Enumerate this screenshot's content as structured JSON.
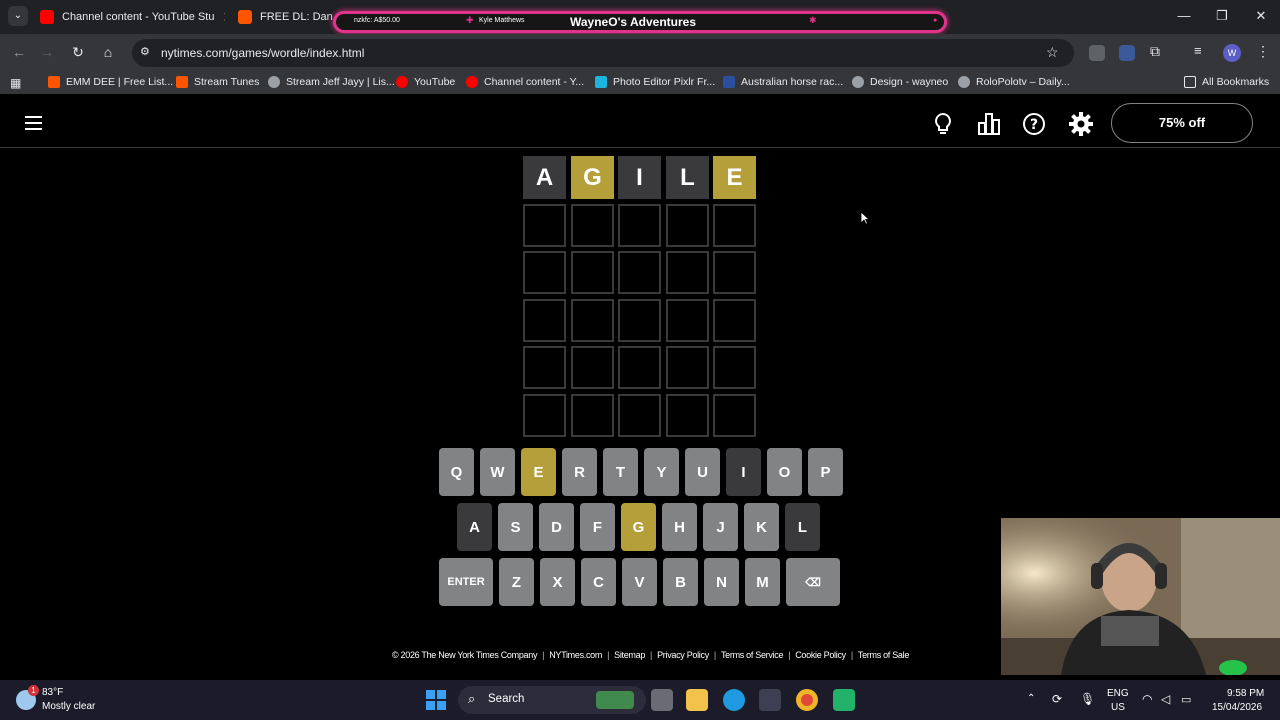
{
  "browser": {
    "tabs": [
      {
        "title": "Channel content - YouTube Stu",
        "active": true
      },
      {
        "title": "FREE DL: Daniele"
      }
    ],
    "overlay": {
      "left_text": "nzkfc: A$50.00",
      "user": "Kyle Matthews",
      "title": "WayneO's Adventures"
    },
    "url": "nytimes.com/games/wordle/index.html",
    "profile_initial": "W",
    "bookmarks": [
      "EMM DEE | Free List...",
      "Stream Tunes",
      "Stream Jeff Jayy | Lis...",
      "YouTube",
      "Channel content - Y...",
      "Photo Editor Pixlr Fr...",
      "Australian horse rac...",
      "Design - wayneo",
      "RoloPolotv – Daily..."
    ],
    "all_bookmarks": "All Bookmarks"
  },
  "game": {
    "offer": "75% off",
    "guesses": [
      {
        "letters": [
          "A",
          "G",
          "I",
          "L",
          "E"
        ],
        "states": [
          "absent",
          "present",
          "absent",
          "absent",
          "present"
        ]
      }
    ],
    "keyboard": {
      "row1": [
        {
          "k": "Q"
        },
        {
          "k": "W"
        },
        {
          "k": "E",
          "s": "present"
        },
        {
          "k": "R"
        },
        {
          "k": "T"
        },
        {
          "k": "Y"
        },
        {
          "k": "U"
        },
        {
          "k": "I",
          "s": "absent"
        },
        {
          "k": "O"
        },
        {
          "k": "P"
        }
      ],
      "row2": [
        {
          "k": "A",
          "s": "absent"
        },
        {
          "k": "S"
        },
        {
          "k": "D"
        },
        {
          "k": "F"
        },
        {
          "k": "G",
          "s": "present"
        },
        {
          "k": "H"
        },
        {
          "k": "J"
        },
        {
          "k": "K"
        },
        {
          "k": "L",
          "s": "absent"
        }
      ],
      "row3": [
        {
          "k": "ENTER",
          "wide": true
        },
        {
          "k": "Z"
        },
        {
          "k": "X"
        },
        {
          "k": "C"
        },
        {
          "k": "V"
        },
        {
          "k": "B"
        },
        {
          "k": "N"
        },
        {
          "k": "M"
        },
        {
          "k": "⌫",
          "wide": true
        }
      ]
    },
    "footer": [
      "© 2026 The New York Times Company",
      "NYTimes.com",
      "Sitemap",
      "Privacy Policy",
      "Terms of Service",
      "Cookie Policy",
      "Terms of Sale"
    ]
  },
  "taskbar": {
    "weather_temp": "83°F",
    "weather_desc": "Mostly clear",
    "weather_badge": "1",
    "search": "Search",
    "lang1": "ENG",
    "lang2": "US",
    "time": "9:58 PM",
    "date": "15/04/2026"
  },
  "colors": {
    "present": "#b59f3b",
    "absent": "#3a3a3c",
    "key_default": "#818384",
    "overlay_border": "#e0338a"
  }
}
